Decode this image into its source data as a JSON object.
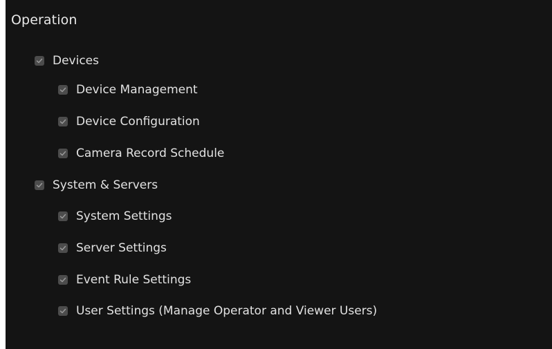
{
  "section": {
    "title": "Operation"
  },
  "groups": [
    {
      "label": "Devices",
      "checked": true,
      "items": [
        {
          "label": "Device Management",
          "checked": true
        },
        {
          "label": "Device Configuration",
          "checked": true
        },
        {
          "label": "Camera Record Schedule",
          "checked": true
        }
      ]
    },
    {
      "label": "System & Servers",
      "checked": true,
      "items": [
        {
          "label": "System Settings",
          "checked": true
        },
        {
          "label": "Server Settings",
          "checked": true
        },
        {
          "label": "Event Rule Settings",
          "checked": true
        },
        {
          "label": "User Settings (Manage Operator and Viewer Users)",
          "checked": true
        }
      ]
    }
  ],
  "colors": {
    "panel_bg": "#141414",
    "checkbox_bg": "#4c4c4c",
    "checkmark": "#9a9a9a",
    "text": "#e2e2e2"
  }
}
